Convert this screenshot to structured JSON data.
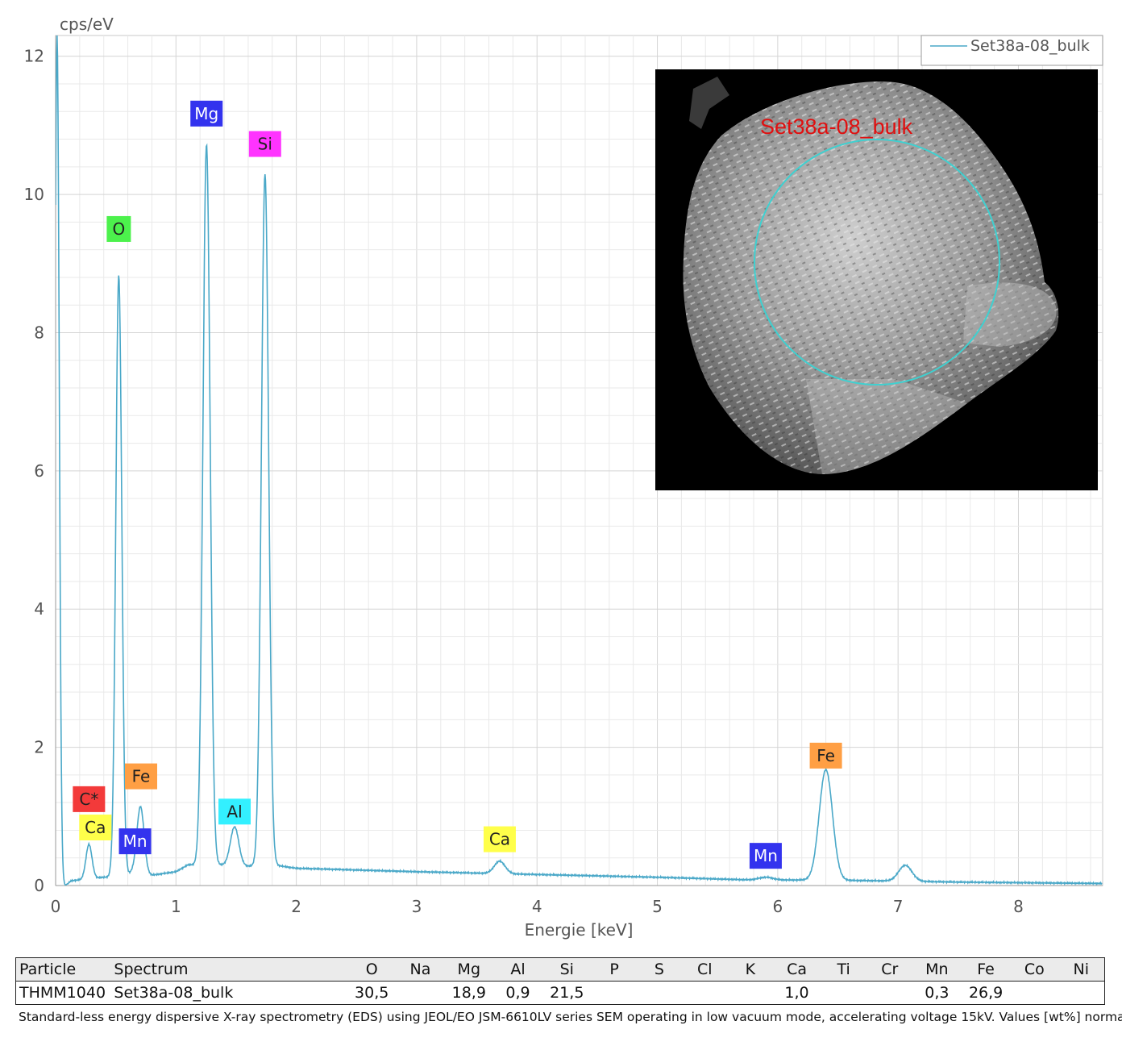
{
  "chart_data": {
    "type": "line",
    "title": "",
    "xlabel": "Energie [keV]",
    "ylabel": "cps/eV",
    "xlim": [
      0,
      8.7
    ],
    "ylim": [
      0,
      12.3
    ],
    "xticks": [
      0,
      1,
      2,
      3,
      4,
      5,
      6,
      7,
      8
    ],
    "yticks": [
      0,
      2,
      4,
      6,
      8,
      10,
      12
    ],
    "grid": true,
    "legend_placement": "top-right",
    "series": [
      {
        "name": "Set38a-08_bulk",
        "color": "#4aa8c8",
        "peaks": [
          {
            "center": 0.012,
            "height": 12.3,
            "width": 0.018
          },
          {
            "center": 0.277,
            "height": 0.5,
            "width": 0.025
          },
          {
            "center": 0.525,
            "height": 8.7,
            "width": 0.025
          },
          {
            "center": 0.637,
            "height": 0.05,
            "width": 0.025
          },
          {
            "center": 0.705,
            "height": 1.0,
            "width": 0.03
          },
          {
            "center": 1.254,
            "height": 10.42,
            "width": 0.03
          },
          {
            "center": 1.487,
            "height": 0.56,
            "width": 0.035
          },
          {
            "center": 1.74,
            "height": 10.0,
            "width": 0.03
          },
          {
            "center": 3.69,
            "height": 0.18,
            "width": 0.045
          },
          {
            "center": 5.9,
            "height": 0.04,
            "width": 0.06
          },
          {
            "center": 6.4,
            "height": 1.6,
            "width": 0.055
          },
          {
            "center": 7.06,
            "height": 0.23,
            "width": 0.055
          }
        ],
        "background": [
          [
            0.0,
            0.0
          ],
          [
            0.08,
            0.0
          ],
          [
            0.13,
            0.07
          ],
          [
            0.25,
            0.09
          ],
          [
            0.4,
            0.12
          ],
          [
            0.55,
            0.13
          ],
          [
            0.8,
            0.15
          ],
          [
            1.0,
            0.2
          ],
          [
            1.1,
            0.3
          ],
          [
            1.2,
            0.3
          ],
          [
            1.35,
            0.3
          ],
          [
            1.6,
            0.28
          ],
          [
            1.8,
            0.3
          ],
          [
            2.0,
            0.25
          ],
          [
            3.0,
            0.2
          ],
          [
            4.0,
            0.16
          ],
          [
            5.0,
            0.12
          ],
          [
            5.8,
            0.08
          ],
          [
            6.3,
            0.08
          ],
          [
            6.8,
            0.07
          ],
          [
            7.5,
            0.05
          ],
          [
            8.7,
            0.03
          ]
        ]
      }
    ],
    "annotations": [
      {
        "label": "C*",
        "x": 0.277,
        "y": 1.25,
        "bg": "#f33a3a",
        "fg": "#222222"
      },
      {
        "label": "Ca",
        "x": 0.33,
        "y": 0.84,
        "bg": "#ffff4a",
        "fg": "#222222"
      },
      {
        "label": "O",
        "x": 0.525,
        "y": 9.5,
        "bg": "#4cf14c",
        "fg": "#222222"
      },
      {
        "label": "Mn",
        "x": 0.66,
        "y": 0.64,
        "bg": "#3333ee",
        "fg": "#ffffff"
      },
      {
        "label": "Fe",
        "x": 0.71,
        "y": 1.58,
        "bg": "#ff9f44",
        "fg": "#222222"
      },
      {
        "label": "Mg",
        "x": 1.254,
        "y": 11.17,
        "bg": "#3333ee",
        "fg": "#ffffff"
      },
      {
        "label": "Al",
        "x": 1.487,
        "y": 1.07,
        "bg": "#33f0ff",
        "fg": "#222222"
      },
      {
        "label": "Si",
        "x": 1.74,
        "y": 10.73,
        "bg": "#ff33ff",
        "fg": "#222222"
      },
      {
        "label": "Ca",
        "x": 3.69,
        "y": 0.67,
        "bg": "#ffff4a",
        "fg": "#222222"
      },
      {
        "label": "Mn",
        "x": 5.9,
        "y": 0.43,
        "bg": "#3333ee",
        "fg": "#ffffff"
      },
      {
        "label": "Fe",
        "x": 6.4,
        "y": 1.88,
        "bg": "#ff9f44",
        "fg": "#222222"
      }
    ]
  },
  "inset": {
    "label": "Set38a-08_bulk",
    "label_color": "#e01010",
    "circle_color": "#3fd0d0",
    "background": "#000000"
  },
  "table": {
    "headers": [
      "Particle",
      "Spectrum",
      "O",
      "Na",
      "Mg",
      "Al",
      "Si",
      "P",
      "S",
      "Cl",
      "K",
      "Ca",
      "Ti",
      "Cr",
      "Mn",
      "Fe",
      "Co",
      "Ni"
    ],
    "rows": [
      [
        "THMM1040",
        "Set38a-08_bulk",
        "30,5",
        "",
        "18,9",
        "0,9",
        "21,5",
        "",
        "",
        "",
        "",
        "1,0",
        "",
        "",
        "0,3",
        "26,9",
        "",
        ""
      ]
    ]
  },
  "footnote": "Standard-less energy dispersive X-ray spectrometry (EDS) using JEOL/EO JSM-6610LV series SEM operating in low vacuum mode, accelerating voltage 15kV. Values [wt%] normalized."
}
